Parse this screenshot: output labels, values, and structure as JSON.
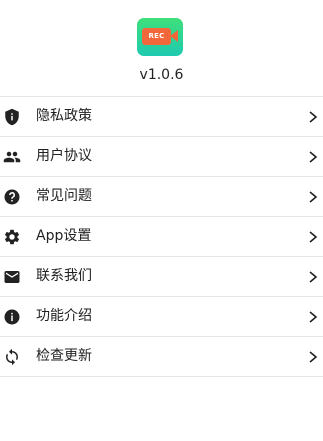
{
  "app": {
    "icon_text": "REC",
    "icon_colors": {
      "top": "#3ee07a",
      "bottom": "#1fc9b0",
      "camera": "#f2683a"
    },
    "version": "v1.0.6"
  },
  "menu": {
    "items": [
      {
        "label": "隐私政策",
        "icon": "shield-icon"
      },
      {
        "label": "用户协议",
        "icon": "people-icon"
      },
      {
        "label": "常见问题",
        "icon": "help-circle-icon"
      },
      {
        "label": "App设置",
        "icon": "gear-icon"
      },
      {
        "label": "联系我们",
        "icon": "mail-icon"
      },
      {
        "label": "功能介绍",
        "icon": "info-icon"
      },
      {
        "label": "检查更新",
        "icon": "refresh-icon"
      }
    ]
  }
}
